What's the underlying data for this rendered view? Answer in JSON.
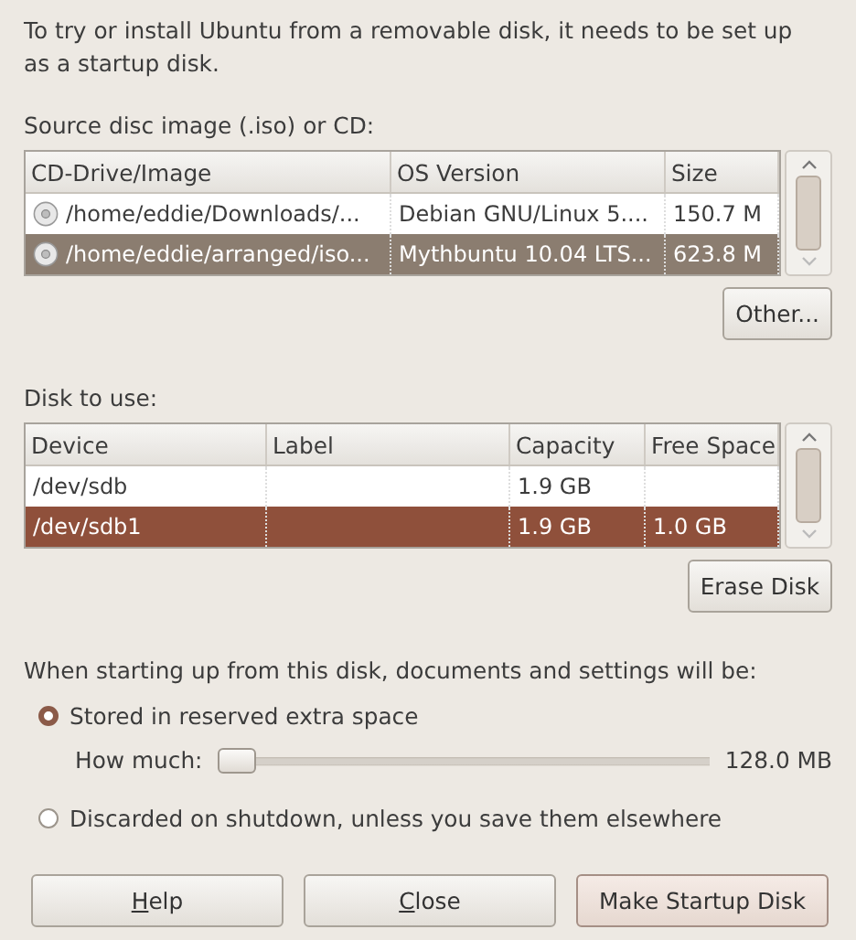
{
  "intro": "To try or install Ubuntu from a removable disk, it needs to be set up as a startup disk.",
  "source": {
    "label": "Source disc image (.iso) or CD:",
    "focused": false,
    "columns": [
      "CD-Drive/Image",
      "OS Version",
      "Size"
    ],
    "rows": [
      {
        "cells": [
          "/home/eddie/Downloads/...",
          "Debian GNU/Linux 5....",
          "150.7 M"
        ],
        "selected": false
      },
      {
        "cells": [
          "/home/eddie/arranged/iso...",
          "Mythbuntu 10.04 LTS...",
          "623.8 M"
        ],
        "selected": true
      }
    ],
    "button": "Other..."
  },
  "disk": {
    "label": "Disk to use:",
    "focused": true,
    "columns": [
      "Device",
      "Label",
      "Capacity",
      "Free Space"
    ],
    "rows": [
      {
        "cells": [
          "/dev/sdb",
          "",
          "1.9 GB",
          ""
        ],
        "selected": false
      },
      {
        "cells": [
          "/dev/sdb1",
          "",
          "1.9 GB",
          "1.0 GB"
        ],
        "selected": true
      }
    ],
    "button": "Erase Disk"
  },
  "persist": {
    "label": "When starting up from this disk, documents and settings will be:",
    "options": [
      {
        "label": "Stored in reserved extra space",
        "selected": true
      },
      {
        "label": "Discarded on shutdown, unless you save them elsewhere",
        "selected": false
      }
    ],
    "slider": {
      "label": "How much:",
      "level": 0.0,
      "reading": "128.0 MB"
    }
  },
  "buttons": [
    {
      "label": "Help",
      "mnemonic": true
    },
    {
      "label": "Close",
      "mnemonic": true
    },
    {
      "label": "Make Startup Disk",
      "mnemonic": false
    }
  ]
}
